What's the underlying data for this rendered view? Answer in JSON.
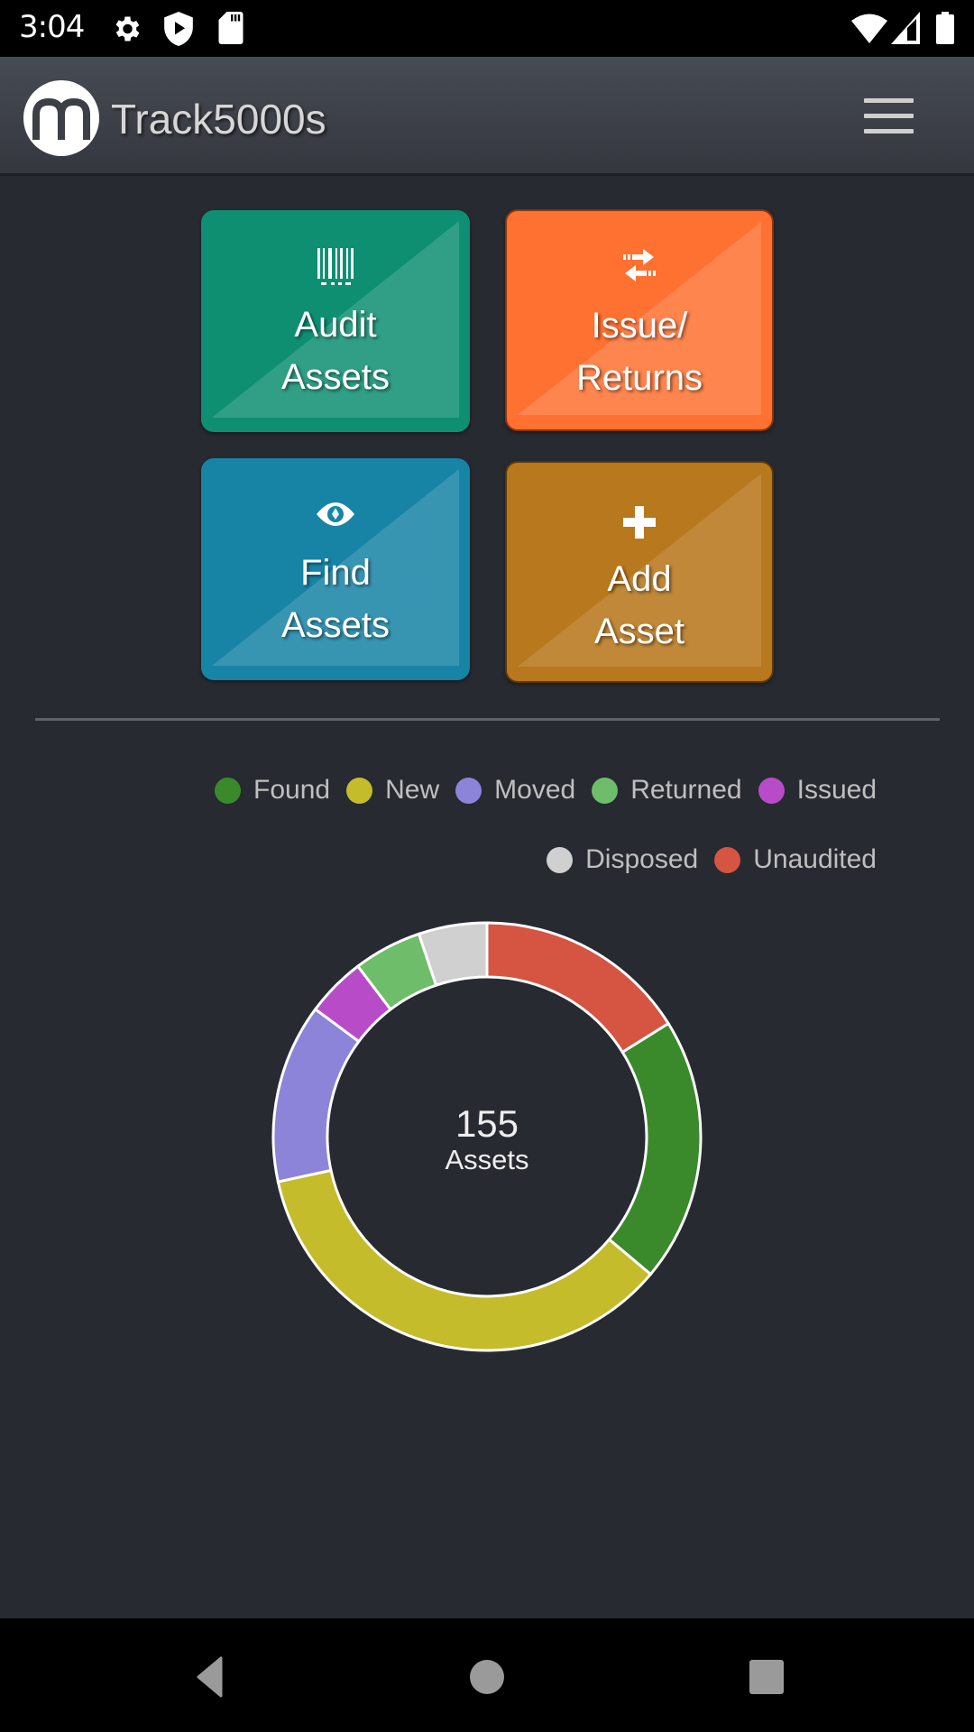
{
  "status_bar": {
    "time": "3:04",
    "left_icons": [
      "gear-icon",
      "play-shield-icon",
      "sd-card-icon"
    ],
    "right_icons": [
      "wifi-icon",
      "cell-signal-icon",
      "battery-icon"
    ]
  },
  "header": {
    "logo_letter": "m",
    "title": "Track5000s",
    "menu_icon": "hamburger-menu-icon"
  },
  "tiles": [
    {
      "id": "audit",
      "line1": "Audit",
      "line2": "Assets",
      "icon": "barcode-icon",
      "color": "#0e8f72"
    },
    {
      "id": "issue",
      "line1": "Issue/",
      "line2": "Returns",
      "icon": "exchange-arrows-icon",
      "color": "#ff7131"
    },
    {
      "id": "find",
      "line1": "Find",
      "line2": "Assets",
      "icon": "eye-icon",
      "color": "#1784a6"
    },
    {
      "id": "add",
      "line1": "Add",
      "line2": "Asset",
      "icon": "plus-icon",
      "color": "#b8781d"
    }
  ],
  "chart_data": {
    "type": "pie",
    "variant": "doughnut",
    "title": "",
    "center_value": "155",
    "center_label": "Assets",
    "legend_position": "top-right",
    "categories": [
      "Found",
      "New",
      "Moved",
      "Returned",
      "Issued",
      "Disposed",
      "Unaudited"
    ],
    "values": [
      31,
      55,
      21,
      8,
      7,
      8,
      25
    ],
    "colors": [
      "#3a8a2c",
      "#c4bc2a",
      "#8c84d8",
      "#6ebd6a",
      "#b84cc8",
      "#d0d0d0",
      "#d65442"
    ],
    "draw_order_clockwise_from_top": [
      "Unaudited",
      "Found",
      "New",
      "Moved",
      "Issued",
      "Returned",
      "Disposed"
    ],
    "total": 155
  },
  "nav_bar": {
    "back": "back-icon",
    "home": "home-icon",
    "recents": "recents-icon"
  }
}
